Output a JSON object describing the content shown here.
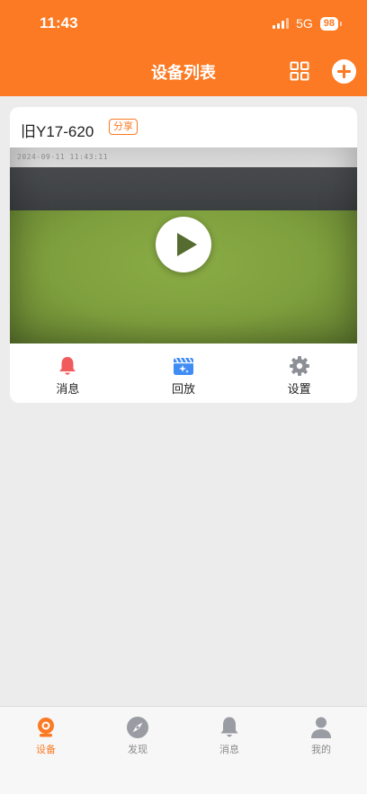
{
  "status_bar": {
    "time": "11:43",
    "network": "5G",
    "battery": "98"
  },
  "header": {
    "title": "设备列表",
    "grid_icon": "grid-icon",
    "add_icon": "plus-circle-icon"
  },
  "device": {
    "name": "旧Y17-620",
    "share_badge": "分享",
    "video_timestamp": "2024-09-11 11:43:11",
    "actions": [
      {
        "label": "消息",
        "icon": "bell-icon",
        "color": "#f25b5b"
      },
      {
        "label": "回放",
        "icon": "playback-clapper-icon",
        "color": "#3f8cf5"
      },
      {
        "label": "设置",
        "icon": "gear-icon",
        "color": "#8c8f96"
      }
    ]
  },
  "tabbar": {
    "items": [
      {
        "label": "设备",
        "icon": "camera-icon",
        "active": true
      },
      {
        "label": "发现",
        "icon": "compass-icon",
        "active": false
      },
      {
        "label": "消息",
        "icon": "bell-icon",
        "active": false
      },
      {
        "label": "我的",
        "icon": "person-icon",
        "active": false
      }
    ]
  },
  "colors": {
    "accent": "#fb7a23",
    "background": "#ececec",
    "inactive_tab": "#9a9ca3"
  }
}
